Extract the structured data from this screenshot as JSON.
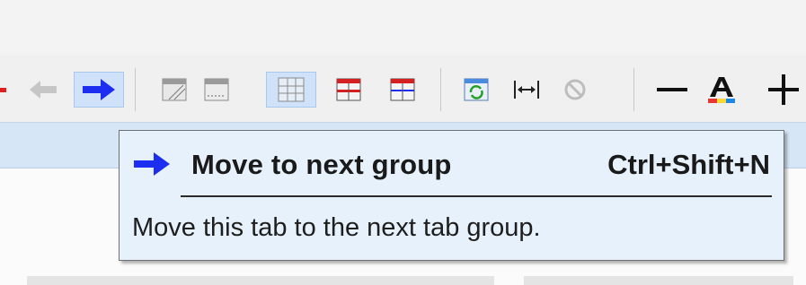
{
  "tooltip": {
    "icon": "arrow-right-icon",
    "title": "Move to next group",
    "shortcut": "Ctrl+Shift+N",
    "description": "Move this tab to the next tab group."
  },
  "toolbar": {
    "buttons": [
      {
        "name": "previous-group-button",
        "icon": "arrow-left-icon",
        "state": "disabled"
      },
      {
        "name": "next-group-button",
        "icon": "arrow-right-icon",
        "state": "pressed"
      },
      {
        "name": "layout-button-1",
        "icon": "layout-hatched-icon"
      },
      {
        "name": "layout-button-2",
        "icon": "layout-dotted-icon"
      },
      {
        "name": "layout-button-3",
        "icon": "layout-grid-icon",
        "state": "pressed"
      },
      {
        "name": "layout-button-4",
        "icon": "layout-split-horizontal-icon"
      },
      {
        "name": "layout-button-5",
        "icon": "layout-split-vertical-icon"
      },
      {
        "name": "refresh-button",
        "icon": "refresh-icon"
      },
      {
        "name": "fit-width-button",
        "icon": "fit-width-icon"
      },
      {
        "name": "stop-button",
        "icon": "stop-icon",
        "state": "disabled"
      },
      {
        "name": "zoom-out-button",
        "icon": "minus-icon"
      },
      {
        "name": "font-color-button",
        "icon": "font-color-icon"
      },
      {
        "name": "zoom-in-button",
        "icon": "plus-icon"
      }
    ],
    "colors": {
      "accent_blue": "#1d2ef0",
      "pressed_bg": "#cfe2fa",
      "tooltip_bg": "#e7f1fb",
      "tab_strip": "#d7e6f6"
    }
  }
}
